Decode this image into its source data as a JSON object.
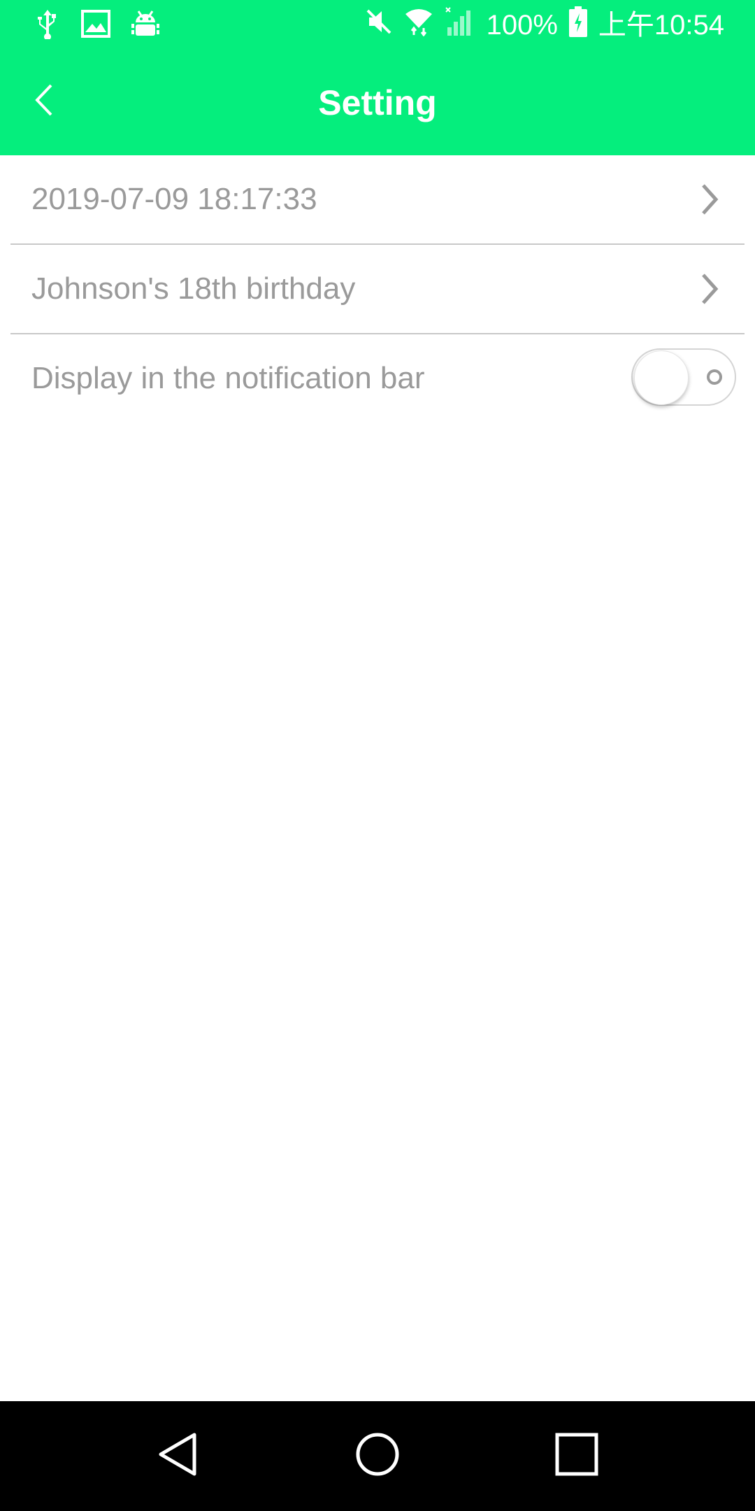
{
  "status_bar": {
    "left_icons": [
      "usb-icon",
      "image-icon",
      "android-debug-icon"
    ],
    "right_icons": [
      "mute-icon",
      "wifi-icon",
      "signal-icon",
      "battery-charging-icon"
    ],
    "battery": "100%",
    "time": "上午10:54"
  },
  "header": {
    "title": "Setting",
    "back_icon": "chevron-left-icon"
  },
  "settings": {
    "items": [
      {
        "label": "2019-07-09 18:17:33",
        "control": "chevron-right-icon"
      },
      {
        "label": "Johnson's 18th birthday",
        "control": "chevron-right-icon"
      },
      {
        "label": "Display in the notification bar",
        "control": "toggle",
        "toggle_on": false
      }
    ]
  },
  "nav_bar": {
    "buttons": [
      "back-triangle-icon",
      "home-circle-icon",
      "recents-square-icon"
    ]
  },
  "colors": {
    "accent": "#05ee7d",
    "label_text": "#9a9a9a",
    "divider": "#c8c8c8"
  }
}
